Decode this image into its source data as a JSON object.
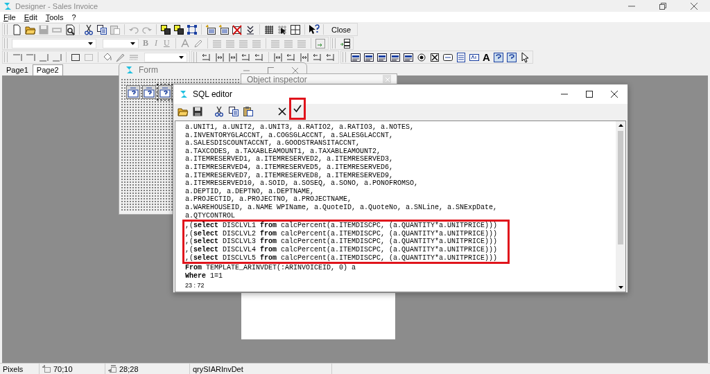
{
  "window": {
    "title": "Designer - Sales Invoice"
  },
  "menu": [
    "File",
    "Edit",
    "Tools",
    "?"
  ],
  "toolbar": {
    "close_button": "Close",
    "format_buttons": [
      "B",
      "I",
      "U"
    ],
    "text_tool": "A"
  },
  "tabs": [
    {
      "label": "Page1",
      "selected": false
    },
    {
      "label": "Page2",
      "selected": true
    }
  ],
  "form_window": {
    "title": "Form"
  },
  "object_inspector": {
    "title": "Object inspector"
  },
  "sql_editor": {
    "title": "SQL editor",
    "toolbar": [
      {
        "kind": "open",
        "highlighted": false
      },
      {
        "kind": "save",
        "highlighted": false
      },
      {
        "kind": "cut",
        "highlighted": false
      },
      {
        "kind": "copy",
        "highlighted": false
      },
      {
        "kind": "paste",
        "highlighted": false
      },
      {
        "kind": "cancel",
        "highlighted": false
      },
      {
        "kind": "apply",
        "highlighted": true
      }
    ],
    "lines_before": [
      "a.UNIT1, a.UNIT2, a.UNIT3, a.RATIO2, a.RATIO3, a.NOTES,",
      "a.INVENTORYGLACCNT, a.COGSGLACCNT, a.SALESGLACCNT,",
      "a.SALESDISCOUNTACCNT, a.GOODSTRANSITACCNT,",
      "a.TAXCODES, a.TAXABLEAMOUNT1, a.TAXABLEAMOUNT2,",
      "a.ITEMRESERVED1, a.ITEMRESERVED2, a.ITEMRESERVED3,",
      "a.ITEMRESERVED4, a.ITEMRESERVED5, a.ITEMRESERVED6,",
      "a.ITEMRESERVED7, a.ITEMRESERVED8, a.ITEMRESERVED9,",
      "a.ITEMRESERVED10, a.SOID, a.SOSEQ, a.SONO, a.PONOFROMSO,",
      "a.DEPTID, a.DEPTNO, a.DEPTNAME,",
      "a.PROJECTID, a.PROJECTNO, a.PROJECTNAME,",
      "a.WAREHOUSEID, a.NAME WPIName, a.QuoteID, a.QuoteNo, a.SNLine, a.SNExpDate,",
      "a.QTYCONTROL"
    ],
    "highlighted_lines": [
      ",(**select** DISCLVL1 **from** calcPercent(a.ITEMDISCPC, (a.QUANTITY*a.UNITPRICE)))",
      ",(**select** DISCLVL2 **from** calcPercent(a.ITEMDISCPC, (a.QUANTITY*a.UNITPRICE)))",
      ",(**select** DISCLVL3 **from** calcPercent(a.ITEMDISCPC, (a.QUANTITY*a.UNITPRICE)))",
      ",(**select** DISCLVL4 **from** calcPercent(a.ITEMDISCPC, (a.QUANTITY*a.UNITPRICE)))",
      ",(**select** DISCLVL5 **from** calcPercent(a.ITEMDISCPC, (a.QUANTITY*a.UNITPRICE)))"
    ],
    "lines_after": [
      "**From** TEMPLATE_ARINVDET(:ARINVOICEID, 0) a",
      "**Where** 1=1"
    ],
    "cursor": "23 : 72"
  },
  "status_bar": [
    {
      "text": "Pixels",
      "kind": "plain"
    },
    {
      "text": "70;10",
      "kind": "position"
    },
    {
      "text": "28;28",
      "kind": "size"
    },
    {
      "text": "qrySIARInvDet",
      "kind": "plain"
    }
  ]
}
